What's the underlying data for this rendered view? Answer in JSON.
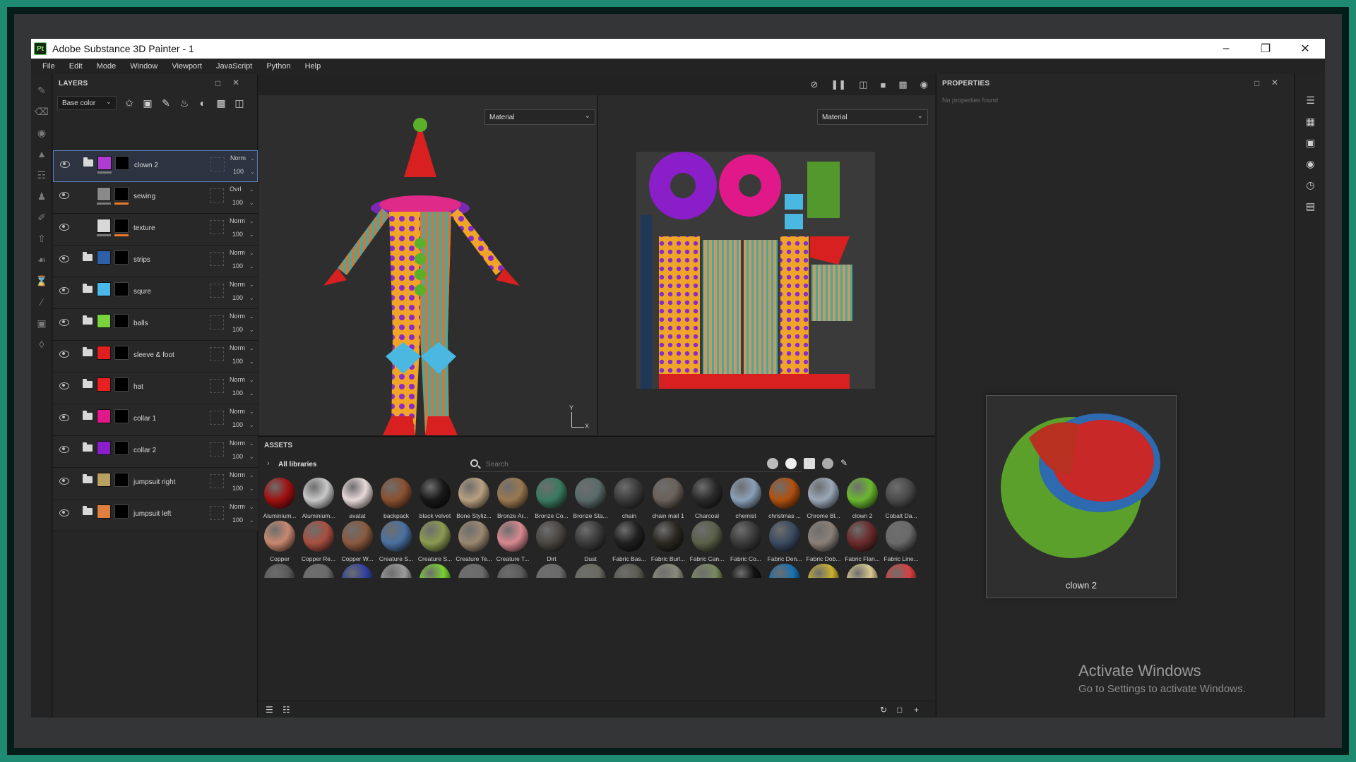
{
  "window": {
    "title": "Adobe Substance 3D Painter - 1",
    "app_icon": "Pt"
  },
  "menu": [
    "File",
    "Edit",
    "Mode",
    "Window",
    "Viewport",
    "JavaScript",
    "Python",
    "Help"
  ],
  "layers_panel": {
    "title": "LAYERS",
    "channel": "Base color",
    "layers": [
      {
        "name": "clown 2",
        "blend": "Norm",
        "opacity": "100",
        "color": "#b03bd0",
        "selected": true,
        "type": "group"
      },
      {
        "name": "sewing",
        "blend": "Ovrl",
        "opacity": "100",
        "color": "#8a8a8a",
        "type": "fill"
      },
      {
        "name": "texture",
        "blend": "Norm",
        "opacity": "100",
        "color": "#d8d8d8",
        "type": "fill"
      },
      {
        "name": "strips",
        "blend": "Norm",
        "opacity": "100",
        "color": "#2e5fa8",
        "type": "folder"
      },
      {
        "name": "squre",
        "blend": "Norm",
        "opacity": "100",
        "color": "#4ab8e8",
        "type": "folder"
      },
      {
        "name": "balls",
        "blend": "Norm",
        "opacity": "100",
        "color": "#7ad23c",
        "type": "folder"
      },
      {
        "name": "sleeve & foot",
        "blend": "Norm",
        "opacity": "100",
        "color": "#e02020",
        "type": "folder"
      },
      {
        "name": "hat",
        "blend": "Norm",
        "opacity": "100",
        "color": "#e82020",
        "type": "folder"
      },
      {
        "name": "collar 1",
        "blend": "Norm",
        "opacity": "100",
        "color": "#e0188a",
        "type": "folder"
      },
      {
        "name": "collar 2",
        "blend": "Norm",
        "opacity": "100",
        "color": "#8a1ec8",
        "type": "folder"
      },
      {
        "name": "jumpsuit right",
        "blend": "Norm",
        "opacity": "100",
        "color": "#b8a060",
        "type": "folder"
      },
      {
        "name": "jumpsuit left",
        "blend": "Norm",
        "opacity": "100",
        "color": "#e08040",
        "type": "folder"
      }
    ]
  },
  "viewport": {
    "material_3d": "Material",
    "material_2d": "Material",
    "axis_y": "Y",
    "axis_x": "X"
  },
  "properties_panel": {
    "title": "PROPERTIES",
    "empty_text": "No properties found"
  },
  "assets_panel": {
    "title": "ASSETS",
    "library": "All libraries",
    "search_placeholder": "Search",
    "row1": [
      {
        "label": "Aluminium...",
        "color": "#a01010"
      },
      {
        "label": "Aluminium...",
        "color": "#c8c8c8"
      },
      {
        "label": "avatat",
        "color": "#e8d8d8"
      },
      {
        "label": "backpack",
        "color": "#8a5030"
      },
      {
        "label": "black velvet",
        "color": "#181818"
      },
      {
        "label": "Bone Styliz...",
        "color": "#b8a080"
      },
      {
        "label": "Bronze Ar...",
        "color": "#9a7850"
      },
      {
        "label": "Bronze Co...",
        "color": "#3a7a60"
      },
      {
        "label": "Bronze Sta...",
        "color": "#5a6a6a"
      },
      {
        "label": "chain",
        "color": "#3a3a3a"
      },
      {
        "label": "chain mail 1",
        "color": "#6a6058"
      },
      {
        "label": "Charcoal",
        "color": "#2a2a2a"
      },
      {
        "label": "chemist",
        "color": "#8aa0b8"
      },
      {
        "label": "christmas ...",
        "color": "#b05010"
      },
      {
        "label": "Chrome Bl...",
        "color": "#9aa8b8"
      },
      {
        "label": "clown 2",
        "color": "#6ab830"
      },
      {
        "label": "Cobalt Da...",
        "color": "#4a4a4a"
      }
    ],
    "row2": [
      {
        "label": "Copper",
        "color": "#c88870"
      },
      {
        "label": "Copper Re...",
        "color": "#a85040"
      },
      {
        "label": "Copper W...",
        "color": "#8a5a40"
      },
      {
        "label": "Creature S...",
        "color": "#4a70a0"
      },
      {
        "label": "Creature S...",
        "color": "#8a9a50"
      },
      {
        "label": "Creature Te...",
        "color": "#9a8870"
      },
      {
        "label": "Creature T...",
        "color": "#d88890"
      },
      {
        "label": "Dirt",
        "color": "#4a4540"
      },
      {
        "label": "Dust",
        "color": "#3a3a3a"
      },
      {
        "label": "Fabric Bas...",
        "color": "#202020"
      },
      {
        "label": "Fabric Burl...",
        "color": "#2a2820"
      },
      {
        "label": "Fabric Can...",
        "color": "#5a6048"
      },
      {
        "label": "Fabric Co...",
        "color": "#3a3a3a"
      },
      {
        "label": "Fabric Den...",
        "color": "#3a4a60"
      },
      {
        "label": "Fabric Dob...",
        "color": "#8a8078"
      },
      {
        "label": "Fabric Flan...",
        "color": "#6a2a2a"
      },
      {
        "label": "Fabric Line...",
        "color": "#6a6a6a"
      }
    ],
    "row3_colors": [
      "#5a5a5a",
      "#6a6a6a",
      "#3040a0",
      "#9a9a9a",
      "#7ad030",
      "#6a6a6a",
      "#5a5a5a",
      "#6a6a6a",
      "#6a6a60",
      "#5a5a50",
      "#8a8a7a",
      "#7a8a60",
      "#111111",
      "#1a70b0",
      "#c8b030",
      "#d8c890",
      "#d84040"
    ]
  },
  "preview": {
    "label": "clown 2"
  },
  "watermark": {
    "title": "Activate Windows",
    "subtitle": "Go to Settings to activate Windows."
  }
}
